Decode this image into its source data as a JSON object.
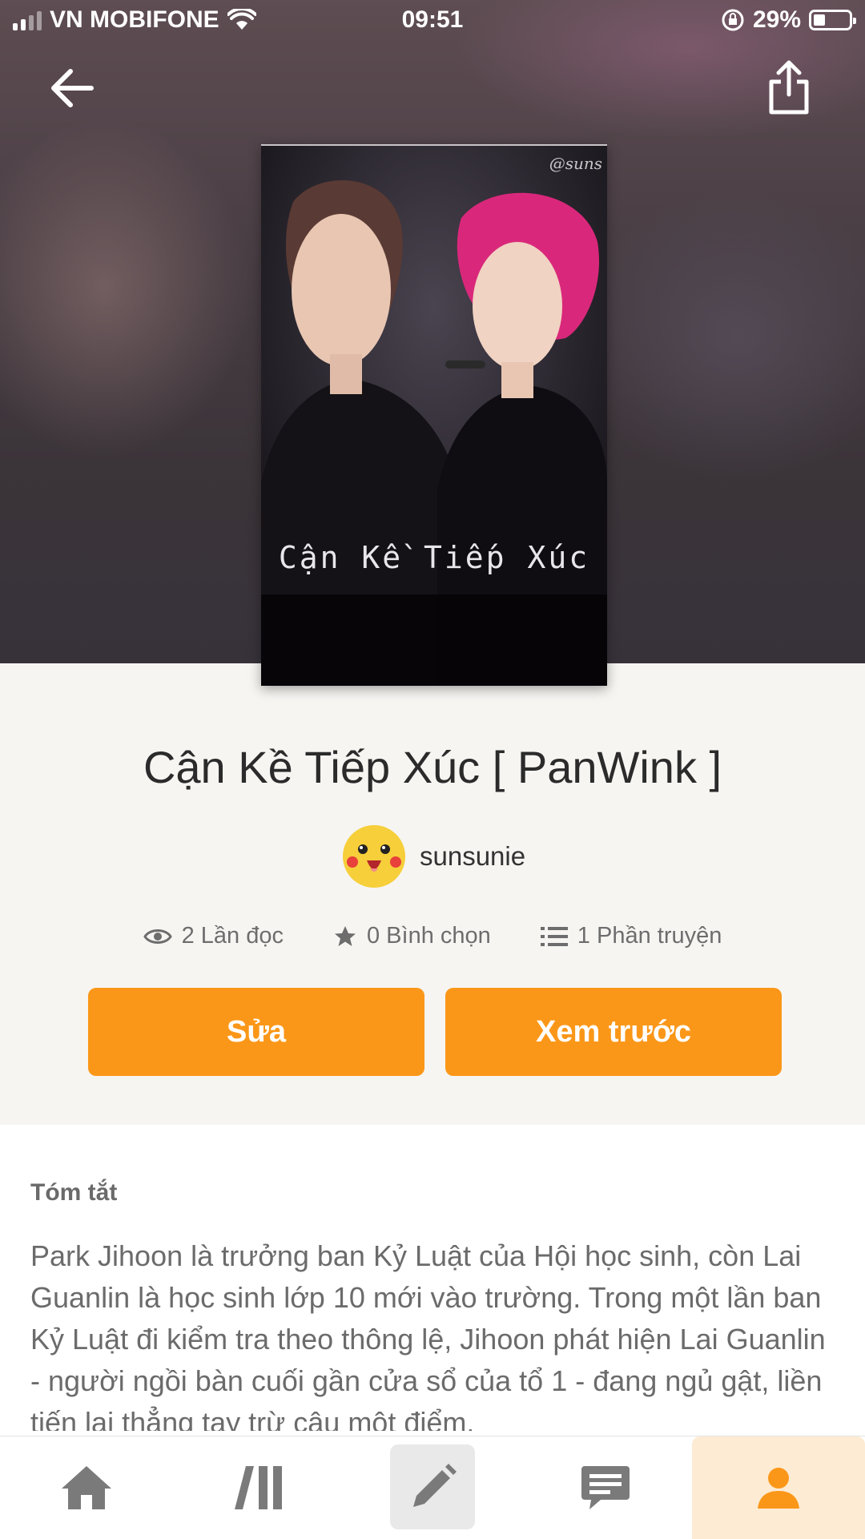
{
  "status_bar": {
    "carrier": "VN MOBIFONE",
    "time": "09:51",
    "battery_percent": "29%"
  },
  "story": {
    "cover_watermark": "@suns",
    "cover_title": "Cận Kề Tiếp Xúc",
    "title": "Cận Kề Tiếp Xúc [ PanWink ]",
    "author": "sunsunie"
  },
  "stats": {
    "reads": "2 Lần đọc",
    "votes": "0 Bình chọn",
    "parts": "1 Phần truyện"
  },
  "actions": {
    "edit_label": "Sửa",
    "preview_label": "Xem trước"
  },
  "summary": {
    "heading": "Tóm tắt",
    "text": "Park Jihoon là trưởng ban Kỷ Luật của Hội học sinh, còn Lai Guanlin là học sinh lớp 10 mới vào trường. Trong một lần ban Kỷ Luật đi kiểm tra theo thông lệ, Jihoon phát hiện Lai Guanlin - người ngồi bàn cuối gần cửa sổ của tổ 1 - đang ngủ gật, liền tiến lại thẳng tay trừ cậu một điểm."
  },
  "bottom_nav": {
    "items": [
      "home-icon",
      "library-icon",
      "write-icon",
      "messages-icon",
      "profile-icon"
    ],
    "active": "profile-icon"
  },
  "colors": {
    "accent": "#fb9718",
    "active_tab_bg": "#fdebd3"
  }
}
